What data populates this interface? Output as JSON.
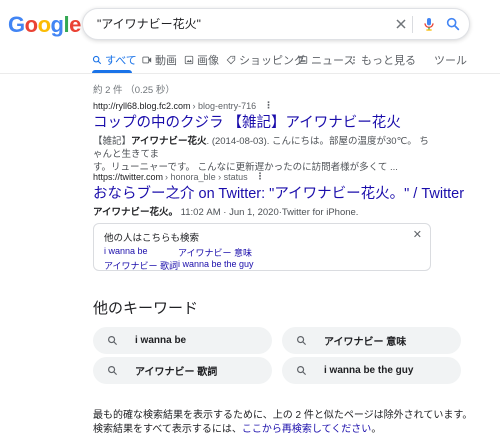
{
  "logo": {
    "letters": [
      "G",
      "o",
      "o",
      "g",
      "l",
      "e"
    ],
    "colors": [
      "#4285F4",
      "#EA4335",
      "#FBBC05",
      "#4285F4",
      "#34A853",
      "#EA4335"
    ]
  },
  "search": {
    "query": "\"アイワナビー花火\""
  },
  "tabs": [
    {
      "label": "すべて",
      "icon": "search-icon"
    },
    {
      "label": "動画",
      "icon": "video-icon"
    },
    {
      "label": "画像",
      "icon": "image-icon"
    },
    {
      "label": "ショッピング",
      "icon": "tag-icon"
    },
    {
      "label": "ニュース",
      "icon": "news-icon"
    },
    {
      "label": "もっと見る",
      "icon": "more-icon"
    },
    {
      "label": "ツール"
    }
  ],
  "stats": "約 2 件 （0.25 秒）",
  "results": [
    {
      "domain": "http://ryll68.blog.fc2.com",
      "path": " › blog-entry-716",
      "title": "コップの中のクジラ 【雑記】アイワナビー花火",
      "snippet_bold_1": "【雑記】",
      "snippet_bold_2": "アイワナビー花火",
      "snippet_rest_1": ". (2014-08-03). こんにちは。部屋の温度が30℃。 ちゃんと生きてま",
      "snippet_rest_2": "す。リューニャーです。 こんなに更新遅かったのに訪問者様が多くて ..."
    },
    {
      "domain": "https://twitter.com",
      "path": " › honora_ble › status",
      "title": "おならブー之介 on Twitter: \"アイワナビー花火。\" / Twitter",
      "snippet_bold_1": "アイワナビー花火。",
      "snippet_rest_1": " 11:02 AM · Jun 1, 2020·Twitter for iPhone."
    }
  ],
  "paa": {
    "title": "他の人はこちらも検索",
    "links": [
      "i wanna be",
      "アイワナビー 意味",
      "アイワナビー 歌詞",
      "i wanna be the guy"
    ]
  },
  "keywords": {
    "title": "他のキーワード",
    "chips": [
      "i wanna be",
      "アイワナビー 意味",
      "アイワナビー 歌詞",
      "i wanna be the guy"
    ]
  },
  "footer": {
    "line1": "最も的確な検索結果を表示するために、上の 2 件と似たページは除外されています。",
    "line2_prefix": "検索結果をすべて表示するには、",
    "line2_link": "ここから再検索してください",
    "line2_suffix": "。"
  }
}
